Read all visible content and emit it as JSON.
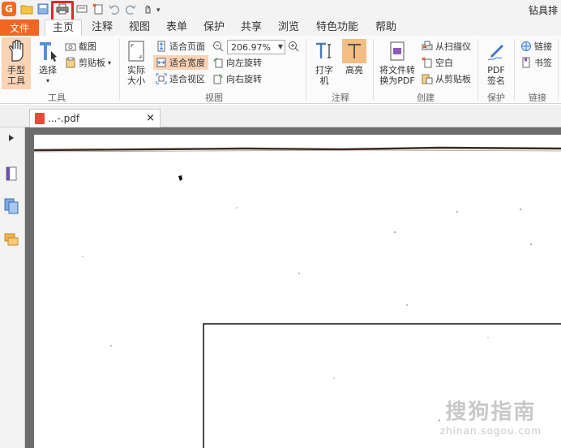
{
  "titlebar": {
    "title_right": "钻具排"
  },
  "menu": {
    "file": "文件",
    "tabs": [
      "主页",
      "注释",
      "视图",
      "表单",
      "保护",
      "共享",
      "浏览",
      "特色功能",
      "帮助"
    ]
  },
  "ribbon": {
    "tools": {
      "hand": "手型工具",
      "select": "选择",
      "screenshot": "截图",
      "clipboard": "剪贴板",
      "group": "工具"
    },
    "view": {
      "actual_size": "实际大小",
      "fit_page": "适合页面",
      "fit_width": "适合宽度",
      "fit_view": "适合视区",
      "zoom": "206.97%",
      "rotate_left": "向左旋转",
      "rotate_right": "向右旋转",
      "group": "视图"
    },
    "annotate": {
      "typewriter": "打字机",
      "highlight": "高亮",
      "group": "注释"
    },
    "create": {
      "to_pdf": "将文件转换为PDF",
      "from_scanner": "从扫描仪",
      "blank": "空白",
      "from_clipboard": "从剪贴板",
      "group": "创建"
    },
    "protect": {
      "pdf_sign": "PDF签名",
      "group": "保护"
    },
    "links": {
      "link": "链接",
      "bookmark": "书签",
      "group": "链接"
    }
  },
  "document_tab": {
    "filename": "...-.pdf"
  },
  "watermark": {
    "line1": "搜狗指南",
    "line2": "zhinan.sogou.com"
  },
  "colors": {
    "accent": "#f26522",
    "highlight_box": "#e0262c",
    "selected_bg": "#fbd3b5"
  }
}
